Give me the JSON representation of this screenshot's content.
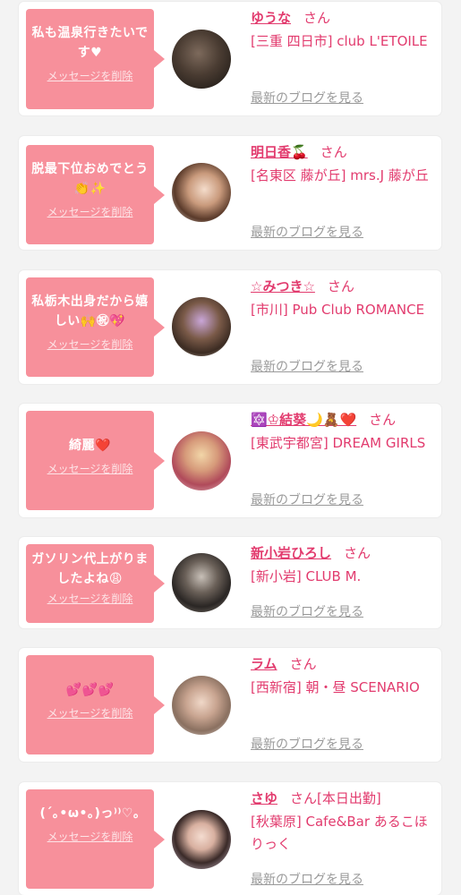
{
  "cards": [
    {
      "message": "私も温泉行きたいです♥",
      "delete_label": "メッセージを削除",
      "name": "ゆうな",
      "suffix": "さん",
      "shop": "[三重 四日市] club L'ETOILE",
      "blog_label": "最新のブログを見る"
    },
    {
      "message": "脱最下位おめでとう👏✨",
      "delete_label": "メッセージを削除",
      "name": "明日香🍒",
      "suffix": "さん",
      "shop": "[名東区 藤が丘] mrs.J 藤が丘",
      "blog_label": "最新のブログを見る"
    },
    {
      "message": "私栃木出身だから嬉しい🙌㊗💖",
      "delete_label": "メッセージを削除",
      "name": "☆みつき☆",
      "suffix": "さん",
      "shop": "[市川] Pub Club ROMANCE",
      "blog_label": "最新のブログを見る"
    },
    {
      "message": "綺麗❤️",
      "delete_label": "メッセージを削除",
      "name": "🔯♔結葵🌙🧸❤️",
      "suffix": "さん",
      "shop": "[東武宇都宮] DREAM GIRLS",
      "blog_label": "最新のブログを見る"
    },
    {
      "message": "ガソリン代上がりましたよね😩",
      "delete_label": "メッセージを削除",
      "name": "新小岩ひろし",
      "suffix": "さん",
      "shop": "[新小岩] CLUB M.",
      "blog_label": "最新のブログを見る"
    },
    {
      "message": "💕💕💕",
      "delete_label": "メッセージを削除",
      "name": "ラム",
      "suffix": "さん",
      "shop": "[西新宿] 朝・昼 SCENARIO",
      "blog_label": "最新のブログを見る"
    },
    {
      "message": "(´｡•ω•｡)っ⁾⁾♡｡",
      "delete_label": "メッセージを削除",
      "name": "さゆ",
      "suffix": "さん[本日出勤]",
      "shop": "[秋葉原] Cafe&Bar あるこほりっく",
      "blog_label": "最新のブログを見る"
    }
  ],
  "colors": {
    "bubble": "#f7909b",
    "accent": "#e23b6e",
    "link_gray": "#9a9a9a",
    "background": "#f3f3f3"
  }
}
